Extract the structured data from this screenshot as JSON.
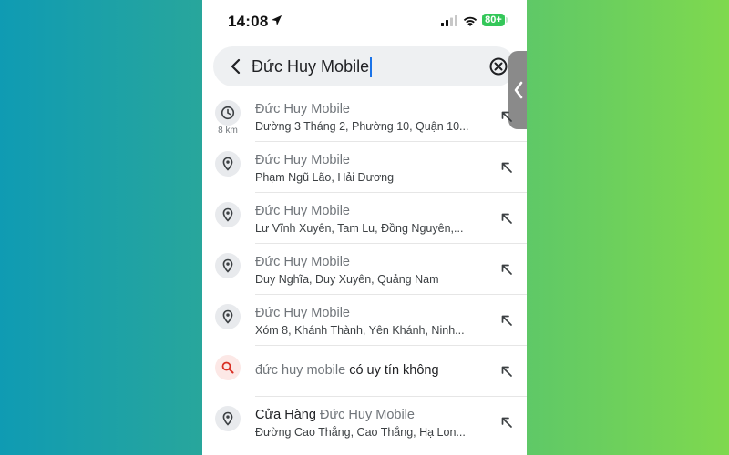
{
  "status_bar": {
    "time": "14:08",
    "battery_label": "80+",
    "icons": [
      "location-arrow-icon",
      "signal-icon",
      "wifi-icon",
      "battery-icon"
    ],
    "battery_color": "#34c759"
  },
  "search": {
    "value": "Đức Huy Mobile",
    "back_icon": "back-chevron-icon",
    "clear_icon": "clear-circle-icon"
  },
  "side_tab": {
    "icon": "chevron-left-icon"
  },
  "results": [
    {
      "icon": "clock-icon",
      "distance": "8 km",
      "title": "Đức Huy Mobile",
      "subtitle": "Đường 3 Tháng 2, Phường 10, Quận 10..."
    },
    {
      "icon": "pin-icon",
      "title": "Đức Huy Mobile",
      "subtitle": "Phạm Ngũ Lão, Hải Dương"
    },
    {
      "icon": "pin-icon",
      "title": "Đức Huy Mobile",
      "subtitle": "Lư Vĩnh Xuyên, Tam Lu, Đồng Nguyên,..."
    },
    {
      "icon": "pin-icon",
      "title": "Đức Huy Mobile",
      "subtitle": "Duy Nghĩa, Duy Xuyên, Quảng Nam"
    },
    {
      "icon": "pin-icon",
      "title": "Đức Huy Mobile",
      "subtitle": "Xóm 8, Khánh Thành, Yên Khánh, Ninh..."
    },
    {
      "icon": "search-icon",
      "query_muted": "đức huy mobile",
      "query_strong": " có uy tín không"
    },
    {
      "icon": "pin-icon",
      "title_strong": "Cửa Hàng ",
      "title": "Đức Huy Mobile",
      "subtitle": "Đường Cao Thắng, Cao Thắng, Hạ Lon..."
    }
  ],
  "colors": {
    "accent": "#1a73e8",
    "search_suggestion_bg": "#fce8e6",
    "search_suggestion_icon": "#d93025"
  }
}
